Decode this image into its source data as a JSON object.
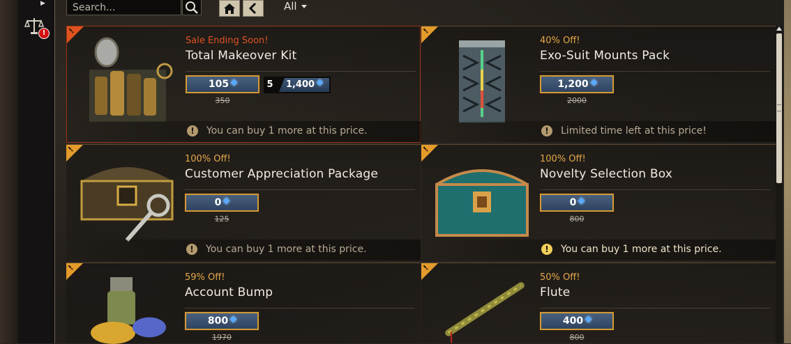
{
  "toolbar": {
    "search_placeholder": "Search...",
    "filter_label": "All"
  },
  "leftnav": {
    "alert_badge": "!"
  },
  "items": [
    {
      "promo": "Sale Ending Soon!",
      "title": "Total Makeover Kit",
      "price": "105",
      "old_price": "350",
      "bundle_qty": "5",
      "bundle_price": "1,400",
      "notice": "You can buy 1 more at this price."
    },
    {
      "promo": "40% Off!",
      "title": "Exo-Suit Mounts Pack",
      "price": "1,200",
      "old_price": "2000",
      "notice": "Limited time left at this price!"
    },
    {
      "promo": "100% Off!",
      "title": "Customer Appreciation Package",
      "price": "0",
      "old_price": "125",
      "notice": "You can buy 1 more at this price."
    },
    {
      "promo": "100% Off!",
      "title": "Novelty Selection Box",
      "price": "0",
      "old_price": "800",
      "notice": "You can buy 1 more at this price."
    },
    {
      "promo": "59% Off!",
      "title": "Account Bump",
      "price": "800",
      "old_price": "1970"
    },
    {
      "promo": "50% Off!",
      "title": "Flute",
      "price": "400",
      "old_price": "800"
    }
  ],
  "colors": {
    "accent_gold": "#e49b2b",
    "sale_red": "#e05323",
    "price_blue": "#48607e",
    "gem_blue": "#58a9ff"
  }
}
